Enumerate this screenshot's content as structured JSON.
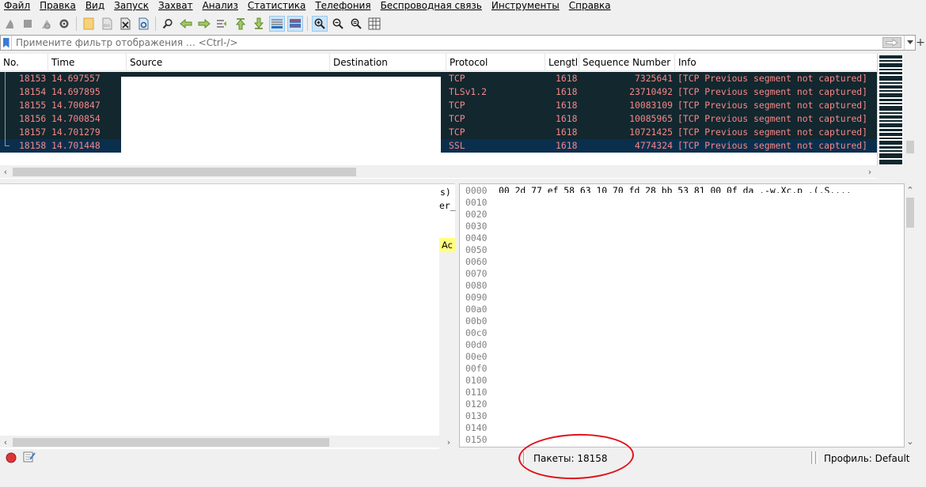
{
  "menu": [
    "Файл",
    "Правка",
    "Вид",
    "Запуск",
    "Захват",
    "Анализ",
    "Статистика",
    "Телефония",
    "Беспроводная связь",
    "Инструменты",
    "Справка"
  ],
  "toolbar": {
    "icons": [
      "shark-fin-start-icon",
      "stop-square-icon",
      "shark-fin-restart-icon",
      "capture-options-gear-icon",
      "open-folder-icon",
      "save-file-icon",
      "close-file-icon",
      "reload-file-icon",
      "find-packet-icon",
      "go-back-arrow-icon",
      "go-forward-arrow-icon",
      "go-to-packet-icon",
      "go-first-packet-icon",
      "go-last-packet-icon",
      "autoscroll-icon",
      "colorize-icon",
      "zoom-in-icon",
      "zoom-out-icon",
      "zoom-normal-icon",
      "resize-columns-icon"
    ]
  },
  "filter": {
    "placeholder": "Примените фильтр отображения … <Ctrl-/>"
  },
  "packet_list": {
    "columns": [
      "No.",
      "Time",
      "Source",
      "Destination",
      "Protocol",
      "Lengtl",
      "Sequence Number",
      "Info"
    ],
    "rows": [
      {
        "no": "18153",
        "time": "14.697557",
        "protocol": "TCP",
        "length": "1618",
        "seq": "7325641",
        "info": "[TCP Previous segment not captured]"
      },
      {
        "no": "18154",
        "time": "14.697895",
        "protocol": "TLSv1.2",
        "length": "1618",
        "seq": "23710492",
        "info": "[TCP Previous segment not captured]"
      },
      {
        "no": "18155",
        "time": "14.700847",
        "protocol": "TCP",
        "length": "1618",
        "seq": "10083109",
        "info": "[TCP Previous segment not captured]"
      },
      {
        "no": "18156",
        "time": "14.700854",
        "protocol": "TCP",
        "length": "1618",
        "seq": "10085965",
        "info": "[TCP Previous segment not captured]"
      },
      {
        "no": "18157",
        "time": "14.701279",
        "protocol": "TCP",
        "length": "1618",
        "seq": "10721425",
        "info": "[TCP Previous segment not captured]"
      },
      {
        "no": "18158",
        "time": "14.701448",
        "protocol": "SSL",
        "length": "1618",
        "seq": "4774324",
        "info": "[TCP Previous segment not captured]"
      }
    ]
  },
  "detail": {
    "fragments": [
      "s)",
      "er_",
      "Ac"
    ]
  },
  "bytes": {
    "offsets": [
      "0000",
      "0010",
      "0020",
      "0030",
      "0040",
      "0050",
      "0060",
      "0070",
      "0080",
      "0090",
      "00a0",
      "00b0",
      "00c0",
      "00d0",
      "00e0",
      "00f0",
      "0100",
      "0110",
      "0120",
      "0130",
      "0140",
      "0150"
    ],
    "first_line": "00 2d 77 ef 58 63 10 70  fd 28 bb 53 81 00 0f da  .-w.Xc.p .(.S...."
  },
  "status": {
    "packets": "Пакеты: 18158",
    "profile": "Профиль: Default"
  },
  "colors": {
    "row_bg": "#12272e",
    "row_selected_bg": "#0a2f4d",
    "row_text": "#f78787",
    "annotation": "#e0121b"
  }
}
